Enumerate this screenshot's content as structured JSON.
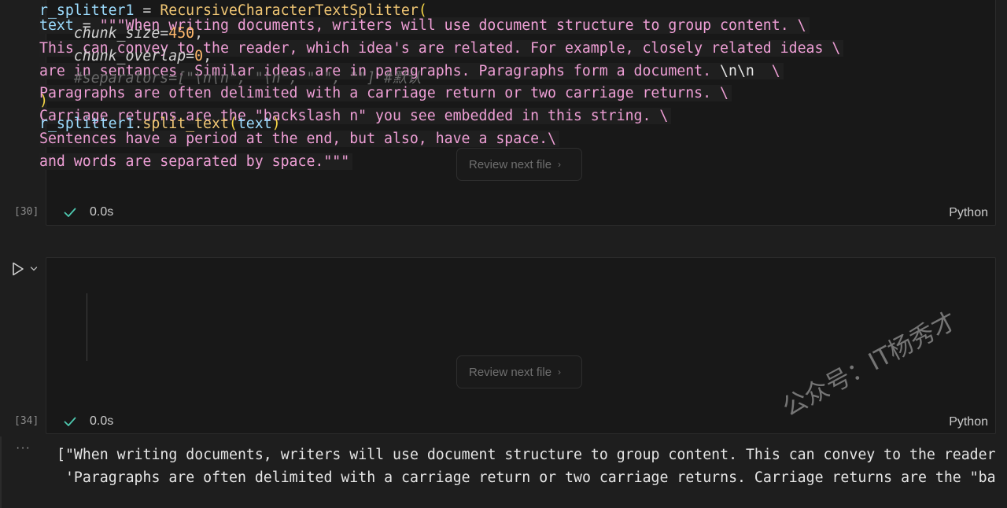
{
  "cells": [
    {
      "execution_count": "[30]",
      "status_time": "0.0s",
      "language": "Python",
      "review_label": "Review next file",
      "code": {
        "l1_var": "text",
        "l1_op": " = ",
        "l1_str": "\"\"\"When writing documents, writers will use document structure to group content. \\",
        "l2": "This can convey to the reader, which idea's are related. For example, closely related ideas \\",
        "l3a": "are in sentances. Similar ideas are in paragraphs. Paragraphs form a document. ",
        "l3b": "\\n\\n",
        "l3c": "  \\",
        "l4": "Paragraphs are often delimited with a carriage return or two carriage returns. \\",
        "l5": "Carriage returns are the \"backslash n\" you see embedded in this string. \\",
        "l6": "Sentences have a period at the end, but also, have a space.\\",
        "l7": "and words are separated by space.\"\"\""
      }
    },
    {
      "execution_count": "[34]",
      "status_time": "0.0s",
      "language": "Python",
      "review_label": "Review next file",
      "code": {
        "l1_var": "r_splitter1",
        "l1_op": " = ",
        "l1_fn": "RecursiveCharacterTextSplitter",
        "l1_paren": "(",
        "l2_param": "chunk_size",
        "l2_op": "=",
        "l2_num": "450",
        "l2_comma": ",",
        "l3_param": "chunk_overlap",
        "l3_op": "=",
        "l3_num": "0",
        "l3_comma": ",",
        "l4_comment": "#separators=[\"\\n\\n\", \"\\n\", \" \", \"\"] #默认",
        "l5_paren": ")",
        "l6_var": "r_splitter1",
        "l6_dot": ".",
        "l6_fn": "split_text",
        "l6_open": "(",
        "l6_arg": "text",
        "l6_close": ")"
      }
    }
  ],
  "output": {
    "more_label": "···",
    "line1": "[\"When writing documents, writers will use document structure to group content. This can convey to the reader, which idea's are related.",
    "line2": " 'Paragraphs are often delimited with a carriage return or two carriage returns. Carriage returns are the \"backslash n\" you see embedded"
  },
  "watermark": "公众号：IT杨秀才",
  "icons": {
    "status": "check-icon",
    "run": "play-icon",
    "run_menu": "chevron-down-icon",
    "review": "chevron-right-icon"
  },
  "colors": {
    "background": "#1e1e1e",
    "cell": "#181818",
    "string": "#ef9fd6",
    "variable": "#9cdcfe",
    "function": "#f0c674",
    "number": "#ffb86c",
    "check": "#4ec9b0"
  }
}
